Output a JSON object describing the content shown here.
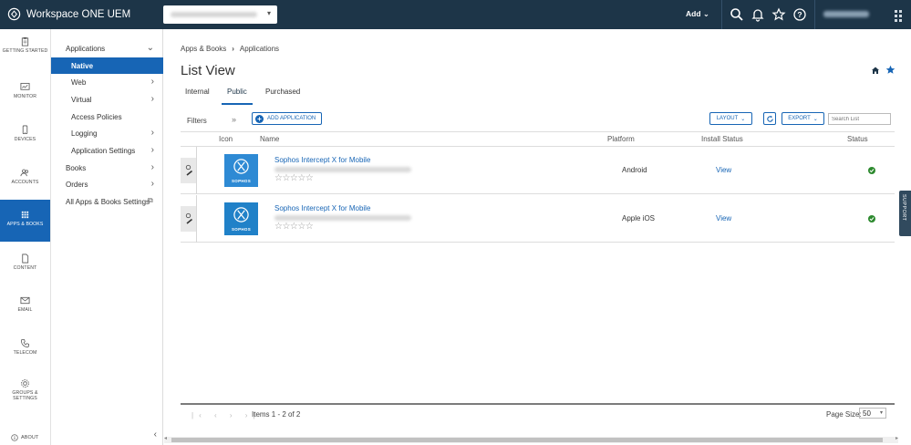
{
  "topbar": {
    "app_title": "Workspace ONE UEM",
    "org_selector": "",
    "add_label": "Add",
    "user_name": ""
  },
  "rail": [
    {
      "label": "GETTING STARTED",
      "icon": "clipboard-icon"
    },
    {
      "label": "MONITOR",
      "icon": "monitor-icon"
    },
    {
      "label": "DEVICES",
      "icon": "device-icon"
    },
    {
      "label": "ACCOUNTS",
      "icon": "accounts-icon"
    },
    {
      "label": "APPS & BOOKS",
      "icon": "apps-grid-icon",
      "active": true
    },
    {
      "label": "CONTENT",
      "icon": "document-icon"
    },
    {
      "label": "EMAIL",
      "icon": "mail-icon"
    },
    {
      "label": "TELECOM",
      "icon": "phone-icon"
    },
    {
      "label": "GROUPS & SETTINGS",
      "icon": "gear-icon"
    },
    {
      "label": "ABOUT",
      "icon": "info-icon"
    }
  ],
  "subnav": {
    "applications": "Applications",
    "native": "Native",
    "web": "Web",
    "virtual": "Virtual",
    "access_policies": "Access Policies",
    "logging": "Logging",
    "application_settings": "Application Settings",
    "books": "Books",
    "orders": "Orders",
    "all_settings": "All Apps & Books Settings"
  },
  "breadcrumb": {
    "root": "Apps & Books",
    "current": "Applications"
  },
  "page_title": "List View",
  "tabs": [
    {
      "label": "Internal"
    },
    {
      "label": "Public",
      "active": true
    },
    {
      "label": "Purchased"
    }
  ],
  "toolbar": {
    "filters": "Filters",
    "add_application": "ADD APPLICATION",
    "layout": "LAYOUT",
    "export": "EXPORT",
    "search_placeholder": "Search List"
  },
  "table": {
    "headers": {
      "icon": "Icon",
      "name": "Name",
      "platform": "Platform",
      "install_status": "Install Status",
      "status": "Status"
    },
    "rows": [
      {
        "name": "Sophos Intercept X for Mobile",
        "bundle_id": "",
        "rating": "☆☆☆☆☆",
        "platform": "Android",
        "install_status": "View",
        "brand": "SOPHOS"
      },
      {
        "name": "Sophos Intercept X for Mobile",
        "bundle_id": "",
        "rating": "☆☆☆☆☆",
        "platform": "Apple iOS",
        "install_status": "View",
        "brand": "SOPHOS"
      }
    ]
  },
  "footer": {
    "items": "Items 1 - 2 of 2",
    "page_size_label": "Page Size:",
    "page_size": "50"
  },
  "support": "SUPPORT",
  "colors": {
    "topbar": "#1d3548",
    "accent": "#1765b5",
    "success": "#2d8a2f"
  }
}
